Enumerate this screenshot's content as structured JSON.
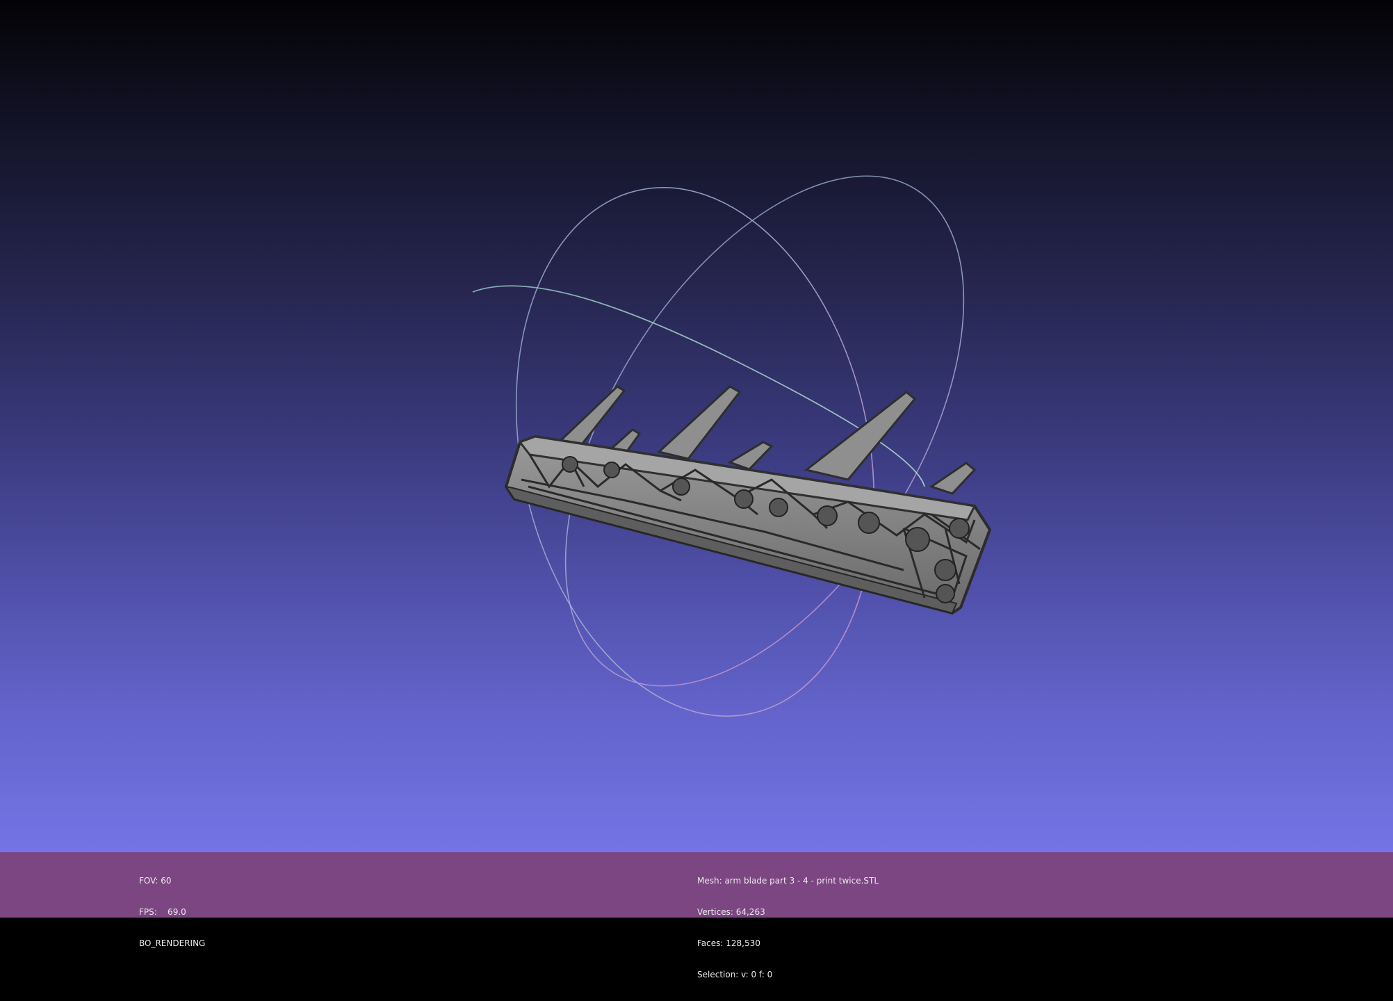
{
  "viewport": {
    "background_top": "#030306",
    "background_bottom": "#7474e6",
    "mesh_color": "#8a8a8a",
    "mesh_edge_color": "#2e2e2e"
  },
  "status_bar": {
    "background": "#7c4682",
    "left": {
      "fov": "FOV: 60",
      "fps": "FPS:    69.0",
      "render_mode": "BO_RENDERING"
    },
    "right": {
      "mesh": "Mesh: arm blade part 3 - 4 - print twice.STL",
      "vertices": "Vertices: 64,263",
      "faces": "Faces: 128,530",
      "selection": "Selection: v: 0 f: 0"
    }
  }
}
